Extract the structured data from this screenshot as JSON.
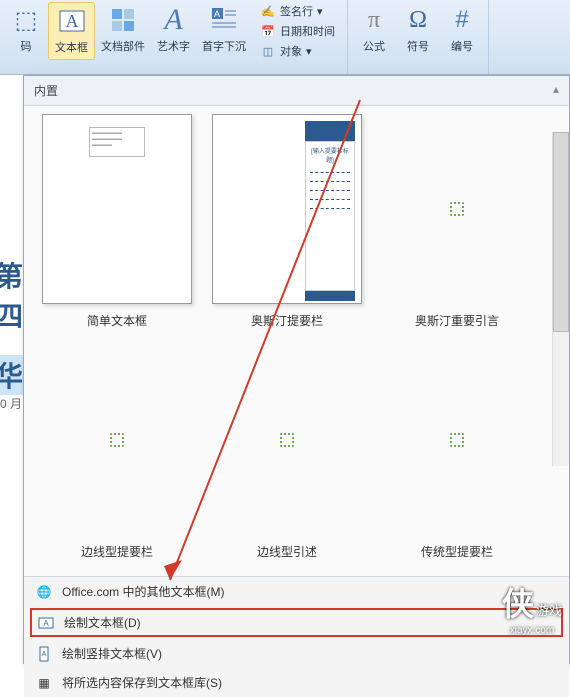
{
  "ribbon": {
    "textbox": "文本框",
    "docparts": "文档部件",
    "wordart": "艺术字",
    "dropcap": "首字下沉",
    "signline": "签名行",
    "datetime": "日期和时间",
    "object": "对象",
    "formula": "公式",
    "symbol": "符号",
    "number": "编号"
  },
  "doc": {
    "title1": "第四",
    "title2": "华",
    "date": "0 月"
  },
  "dd": {
    "header": "内置",
    "items": [
      "简单文本框",
      "奥斯汀提要栏",
      "奥斯汀重要引言",
      "边线型提要栏",
      "边线型引述",
      "传统型提要栏"
    ]
  },
  "menu": {
    "office": "Office.com 中的其他文本框(M)",
    "draw": "绘制文本框(D)",
    "drawv": "绘制竖排文本框(V)",
    "save": "将所选内容保存到文本框库(S)"
  },
  "watermark": {
    "main": "侠",
    "sub": "游戏",
    "url": "xiayx.com"
  }
}
